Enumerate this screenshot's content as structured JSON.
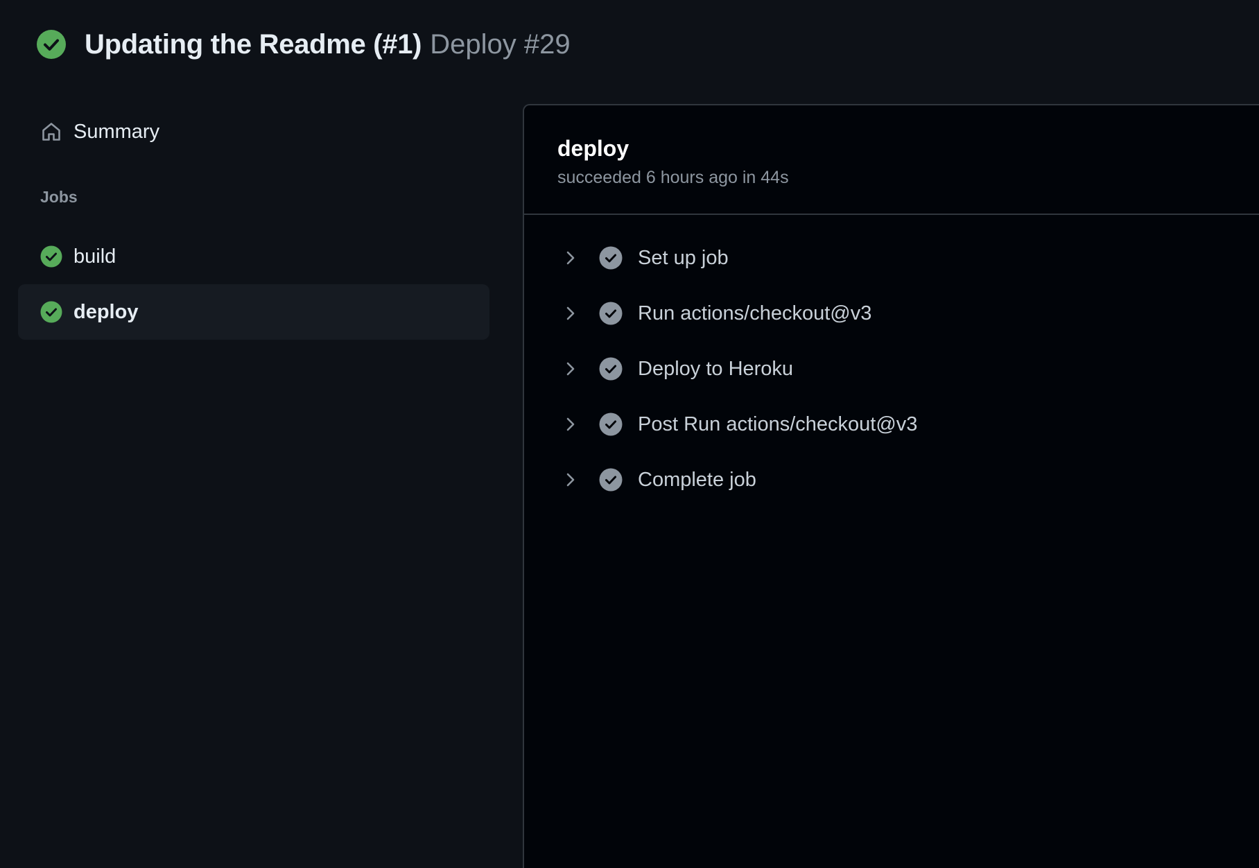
{
  "header": {
    "title": "Updating the Readme (#1)",
    "subtitle": "Deploy #29",
    "status_icon": "check-circle-fill-icon"
  },
  "sidebar": {
    "summary_label": "Summary",
    "summary_icon": "home-icon",
    "jobs_heading": "Jobs",
    "jobs": [
      {
        "label": "build",
        "status": "success",
        "active": false
      },
      {
        "label": "deploy",
        "status": "success",
        "active": true
      }
    ]
  },
  "main": {
    "job_title": "deploy",
    "job_meta": "succeeded 6 hours ago in 44s",
    "steps": [
      {
        "label": "Set up job",
        "status": "success"
      },
      {
        "label": "Run actions/checkout@v3",
        "status": "success"
      },
      {
        "label": "Deploy to Heroku",
        "status": "success"
      },
      {
        "label": "Post Run actions/checkout@v3",
        "status": "success"
      },
      {
        "label": "Complete job",
        "status": "success"
      }
    ]
  },
  "colors": {
    "background": "#0d1117",
    "panel_background": "#010409",
    "active_item": "#161b22",
    "success_green": "#3fb950",
    "step_check_gray": "#8d96a0",
    "border": "#30363d",
    "text_primary": "#e6edf3",
    "text_muted": "#8d96a0"
  }
}
